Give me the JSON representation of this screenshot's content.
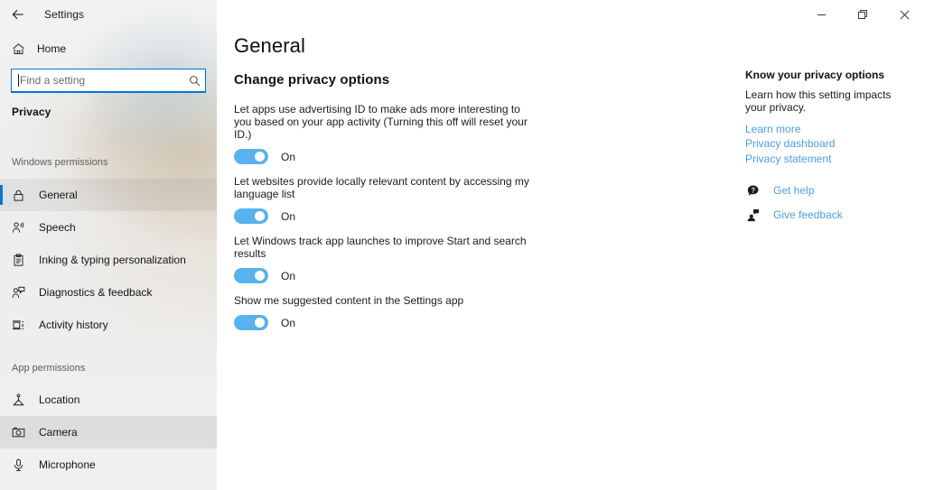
{
  "window": {
    "app_title": "Settings",
    "back_icon": "back-arrow-icon",
    "minimize_label": "Minimize",
    "maximize_label": "Restore",
    "close_label": "Close"
  },
  "sidebar": {
    "home": {
      "label": "Home",
      "icon": "home-icon"
    },
    "search": {
      "placeholder": "Find a setting",
      "value": "",
      "icon": "search-icon"
    },
    "category": "Privacy",
    "groups": [
      {
        "label": "Windows permissions",
        "items": [
          {
            "label": "General",
            "icon": "lock-icon",
            "selected": true,
            "hovered": false
          },
          {
            "label": "Speech",
            "icon": "speech-person-icon",
            "selected": false,
            "hovered": false
          },
          {
            "label": "Inking & typing personalization",
            "icon": "clipboard-icon",
            "selected": false,
            "hovered": false
          },
          {
            "label": "Diagnostics & feedback",
            "icon": "feedback-person-icon",
            "selected": false,
            "hovered": false
          },
          {
            "label": "Activity history",
            "icon": "activity-history-icon",
            "selected": false,
            "hovered": false
          }
        ]
      },
      {
        "label": "App permissions",
        "items": [
          {
            "label": "Location",
            "icon": "location-pin-icon",
            "selected": false,
            "hovered": false
          },
          {
            "label": "Camera",
            "icon": "camera-icon",
            "selected": false,
            "hovered": true
          },
          {
            "label": "Microphone",
            "icon": "microphone-icon",
            "selected": false,
            "hovered": false
          }
        ]
      }
    ]
  },
  "main": {
    "page_title": "General",
    "section_title": "Change privacy options",
    "settings": [
      {
        "description": "Let apps use advertising ID to make ads more interesting to you based on your app activity (Turning this off will reset your ID.)",
        "state": "On",
        "on": true
      },
      {
        "description": "Let websites provide locally relevant content by accessing my language list",
        "state": "On",
        "on": true
      },
      {
        "description": "Let Windows track app launches to improve Start and search results",
        "state": "On",
        "on": true
      },
      {
        "description": "Show me suggested content in the Settings app",
        "state": "On",
        "on": true
      }
    ]
  },
  "right_panel": {
    "title": "Know your privacy options",
    "text": "Learn how this setting impacts your privacy.",
    "links": [
      {
        "label": "Learn more"
      },
      {
        "label": "Privacy dashboard"
      },
      {
        "label": "Privacy statement"
      }
    ],
    "help": [
      {
        "label": "Get help",
        "icon": "help-bubble-icon"
      },
      {
        "label": "Give feedback",
        "icon": "give-feedback-icon"
      }
    ]
  },
  "colors": {
    "accent": "#0078d4",
    "toggle_on": "#58b2ed",
    "link": "#4a9fe0"
  }
}
